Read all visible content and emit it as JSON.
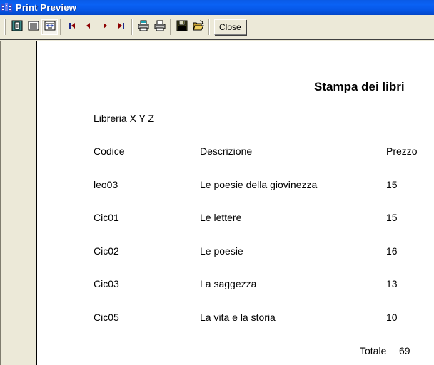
{
  "window": {
    "title": "Print Preview",
    "icon": "print-preview-app-icon"
  },
  "toolbar": {
    "buttons": [
      {
        "name": "one-page",
        "icon": "one-page-icon"
      },
      {
        "name": "two-pages",
        "icon": "multi-page-icon"
      },
      {
        "name": "zoom-fit",
        "icon": "fit-width-icon",
        "pressed": true
      },
      {
        "name": "first-page",
        "icon": "first-page-icon"
      },
      {
        "name": "previous-page",
        "icon": "previous-page-icon"
      },
      {
        "name": "next-page",
        "icon": "next-page-icon"
      },
      {
        "name": "last-page",
        "icon": "last-page-icon"
      },
      {
        "name": "print-setup",
        "icon": "printer-setup-icon"
      },
      {
        "name": "print",
        "icon": "printer-icon"
      },
      {
        "name": "save",
        "icon": "save-disk-icon"
      },
      {
        "name": "open",
        "icon": "open-folder-icon"
      }
    ],
    "close_label": "Close"
  },
  "report": {
    "title": "Stampa dei libri",
    "subtitle": "Libreria X Y Z",
    "columns": [
      "Codice",
      "Descrizione",
      "Prezzo"
    ],
    "rows": [
      {
        "codice": "leo03",
        "descrizione": "Le poesie della giovinezza",
        "prezzo": "15"
      },
      {
        "codice": "Cic01",
        "descrizione": "Le lettere",
        "prezzo": "15"
      },
      {
        "codice": "Cic02",
        "descrizione": "Le poesie",
        "prezzo": "16"
      },
      {
        "codice": "Cic03",
        "descrizione": "La saggezza",
        "prezzo": "13"
      },
      {
        "codice": "Cic05",
        "descrizione": "La vita e la storia",
        "prezzo": "10"
      }
    ],
    "total_label": "Totale",
    "total_value": "69"
  }
}
